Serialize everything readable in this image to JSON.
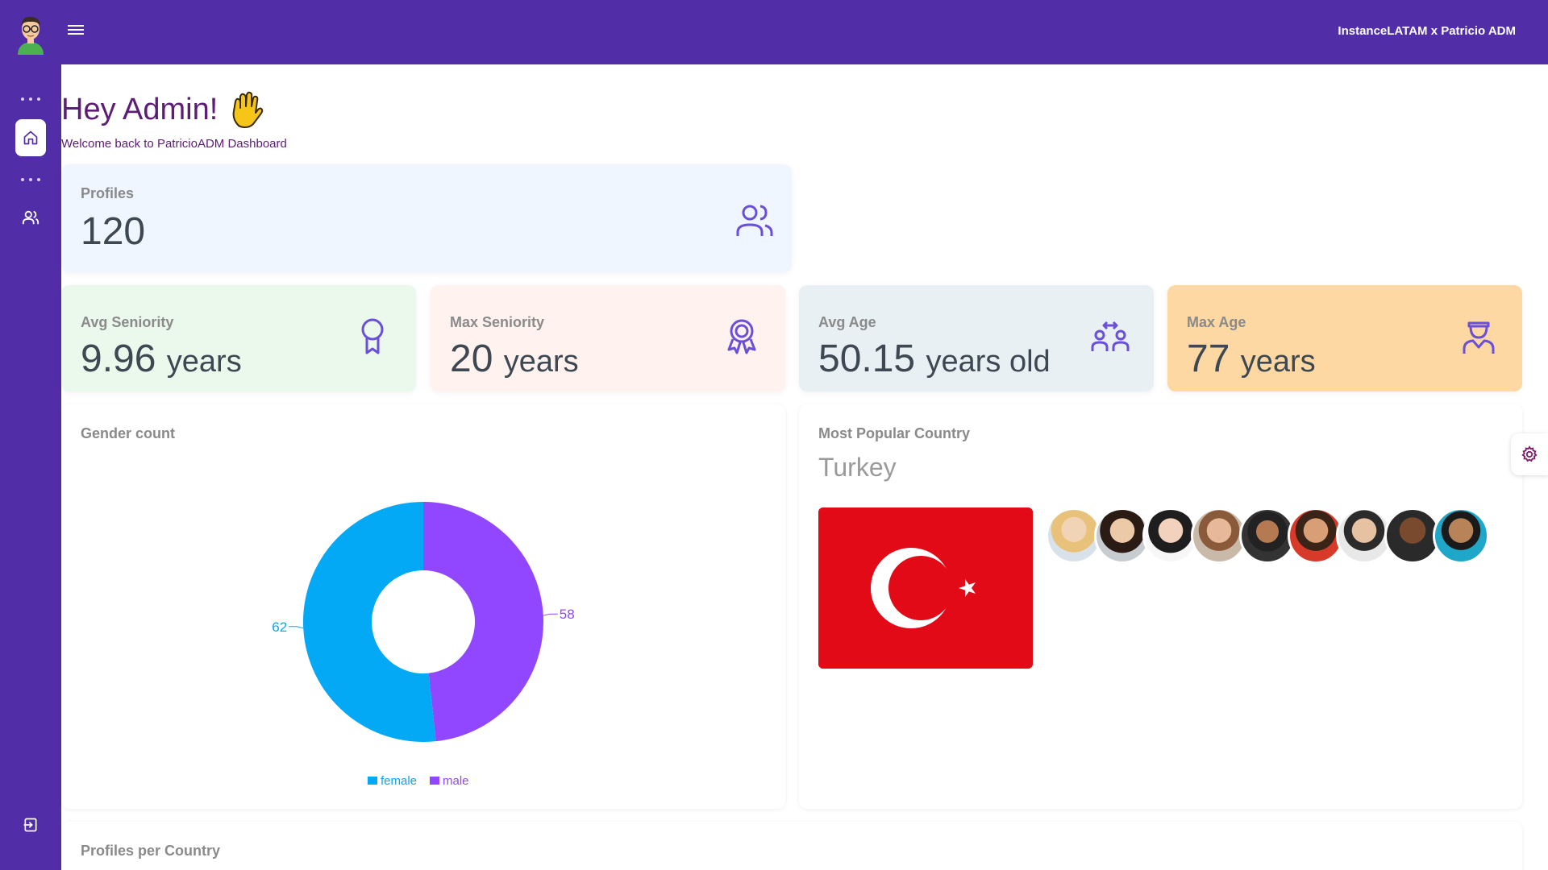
{
  "topbar": {
    "user_label": "InstanceLATAM x Patricio ADM"
  },
  "greeting": {
    "title": "Hey Admin!",
    "subtitle": "Welcome back to PatricioADM Dashboard"
  },
  "cards": {
    "profiles": {
      "label": "Profiles",
      "value": "120",
      "icon": "users-icon"
    },
    "avg_seniority": {
      "label": "Avg Seniority",
      "value": "9.96",
      "unit": "years",
      "icon": "award-ribbon-icon"
    },
    "max_seniority": {
      "label": "Max Seniority",
      "value": "20",
      "unit": "years",
      "icon": "award-badge-icon"
    },
    "avg_age": {
      "label": "Avg Age",
      "value": "50.15",
      "unit": "years old",
      "icon": "people-arrows-icon"
    },
    "max_age": {
      "label": "Max Age",
      "value": "77",
      "unit": "years",
      "icon": "user-icon"
    }
  },
  "gender_panel": {
    "title": "Gender count"
  },
  "country_panel": {
    "title": "Most Popular Country",
    "country": "Turkey"
  },
  "bottom_panel": {
    "title": "Profiles per Country"
  },
  "colors": {
    "primary": "#512da8",
    "female": "#03a9f4",
    "male": "#9147ff",
    "flag_red": "#e30a17"
  },
  "chart_data": {
    "type": "pie",
    "title": "Gender count",
    "categories": [
      "female",
      "male"
    ],
    "values": [
      62,
      58
    ],
    "colors": [
      "#03a9f4",
      "#9147ff"
    ],
    "legend": "bottom"
  }
}
